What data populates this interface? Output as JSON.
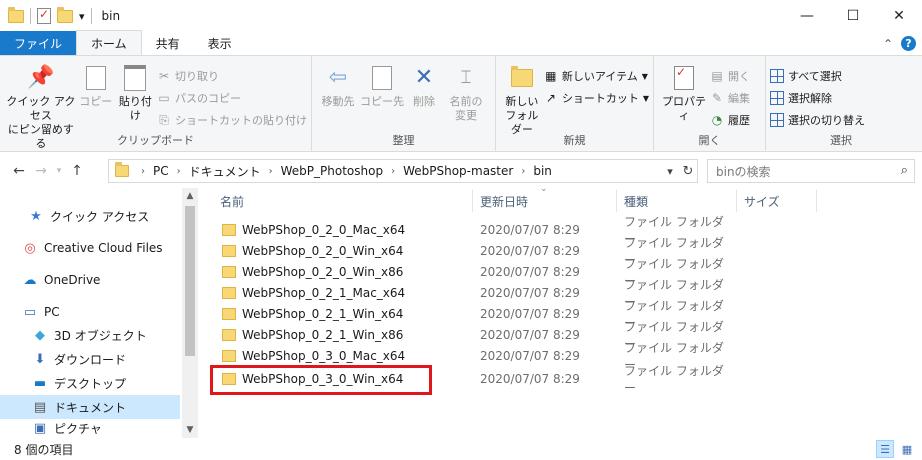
{
  "window": {
    "title": "bin",
    "controls": {
      "minimize": "—",
      "maximize": "☐",
      "close": "✕"
    }
  },
  "quick_access": {
    "dropdown": "▾"
  },
  "ribbon_tabs": [
    {
      "label": "ファイル"
    },
    {
      "label": "ホーム"
    },
    {
      "label": "共有"
    },
    {
      "label": "表示"
    }
  ],
  "ribbon_collapse": "⌃",
  "help": "?",
  "ribbon": {
    "clipboard": {
      "label": "クリップボード",
      "pin": "クイック アクセス\nにピン留めする",
      "pin_line1": "クイック アクセス",
      "pin_line2": "にピン留めする",
      "copy": "コピー",
      "paste": "貼り付け",
      "cut": "切り取り",
      "copy_path": "パスのコピー",
      "paste_shortcut": "ショートカットの貼り付け"
    },
    "organize": {
      "label": "整理",
      "move_to": "移動先",
      "copy_to": "コピー先",
      "delete": "削除",
      "rename_line1": "名前の",
      "rename_line2": "変更"
    },
    "new": {
      "label": "新規",
      "new_folder_line1": "新しい",
      "new_folder_line2": "フォルダー",
      "new_item": "新しいアイテム",
      "shortcut": "ショートカット"
    },
    "open": {
      "label": "開く",
      "properties": "プロパティ",
      "open": "開く",
      "edit": "編集",
      "history": "履歴"
    },
    "select": {
      "label": "選択",
      "select_all": "すべて選択",
      "select_none": "選択解除",
      "invert": "選択の切り替え"
    }
  },
  "address": {
    "crumbs": [
      "PC",
      "ドキュメント",
      "WebP_Photoshop",
      "WebPShop-master",
      "bin"
    ],
    "search_placeholder": "binの検索"
  },
  "nav_pane": {
    "items": [
      {
        "label": "クイック アクセス",
        "icon": "star-icon"
      },
      {
        "label": "Creative Cloud Files",
        "icon": "creative-cloud-icon"
      },
      {
        "label": "OneDrive",
        "icon": "cloud-icon"
      },
      {
        "label": "PC",
        "icon": "pc-icon"
      },
      {
        "label": "3D オブジェクト",
        "icon": "cube-icon"
      },
      {
        "label": "ダウンロード",
        "icon": "download-icon"
      },
      {
        "label": "デスクトップ",
        "icon": "desktop-icon"
      },
      {
        "label": "ドキュメント",
        "icon": "document-icon"
      },
      {
        "label": "ピクチャ",
        "icon": "pictures-icon"
      }
    ]
  },
  "columns": {
    "name": "名前",
    "date": "更新日時",
    "type": "種類",
    "size": "サイズ"
  },
  "files": [
    {
      "name": "WebPShop_0_2_0_Mac_x64",
      "date": "2020/07/07 8:29",
      "type": "ファイル フォルダー"
    },
    {
      "name": "WebPShop_0_2_0_Win_x64",
      "date": "2020/07/07 8:29",
      "type": "ファイル フォルダー"
    },
    {
      "name": "WebPShop_0_2_0_Win_x86",
      "date": "2020/07/07 8:29",
      "type": "ファイル フォルダー"
    },
    {
      "name": "WebPShop_0_2_1_Mac_x64",
      "date": "2020/07/07 8:29",
      "type": "ファイル フォルダー"
    },
    {
      "name": "WebPShop_0_2_1_Win_x64",
      "date": "2020/07/07 8:29",
      "type": "ファイル フォルダー"
    },
    {
      "name": "WebPShop_0_2_1_Win_x86",
      "date": "2020/07/07 8:29",
      "type": "ファイル フォルダー"
    },
    {
      "name": "WebPShop_0_3_0_Mac_x64",
      "date": "2020/07/07 8:29",
      "type": "ファイル フォルダー"
    },
    {
      "name": "WebPShop_0_3_0_Win_x64",
      "date": "2020/07/07 8:29",
      "type": "ファイル フォルダー"
    }
  ],
  "status": {
    "item_count": "8 個の項目"
  },
  "colors": {
    "accent": "#1979ca",
    "selection": "#cce8ff",
    "highlight": "#e0161b"
  }
}
